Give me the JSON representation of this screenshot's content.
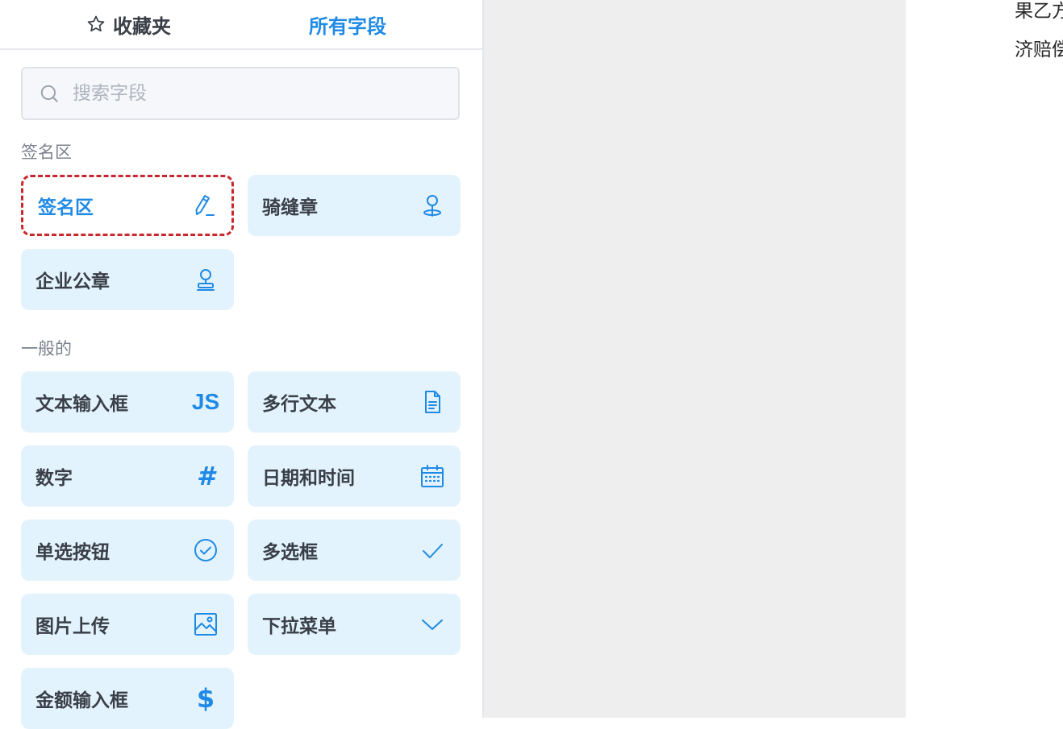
{
  "tabs": {
    "favorites_label": "收藏夹",
    "all_fields_label": "所有字段"
  },
  "search": {
    "placeholder": "搜索字段",
    "value": ""
  },
  "sections": {
    "signature_title": "签名区",
    "general_title": "一般的"
  },
  "signature_fields": [
    {
      "label": "签名区",
      "icon": "pen-icon",
      "selected": true
    },
    {
      "label": "骑缝章",
      "icon": "stamp-icon"
    },
    {
      "label": "企业公章",
      "icon": "stamp-icon"
    }
  ],
  "general_fields": [
    {
      "label": "文本输入框",
      "icon": "js-icon",
      "glyph": "JS"
    },
    {
      "label": "多行文本",
      "icon": "document-icon"
    },
    {
      "label": "数字",
      "icon": "hash-icon",
      "glyph": "#"
    },
    {
      "label": "日期和时间",
      "icon": "calendar-icon"
    },
    {
      "label": "单选按钮",
      "icon": "check-circle-icon"
    },
    {
      "label": "多选框",
      "icon": "checkmark-icon"
    },
    {
      "label": "图片上传",
      "icon": "image-icon"
    },
    {
      "label": "下拉菜单",
      "icon": "chevron-down-icon"
    },
    {
      "label": "金额输入框",
      "icon": "dollar-icon",
      "glyph": "$"
    }
  ],
  "document": {
    "line1": "果乙方",
    "line2": "济赔偿"
  },
  "colors": {
    "accent": "#1f8ae6",
    "card_bg": "#e3f3fd",
    "selected_border": "#c8282d",
    "canvas_bg": "#eeeeee"
  }
}
